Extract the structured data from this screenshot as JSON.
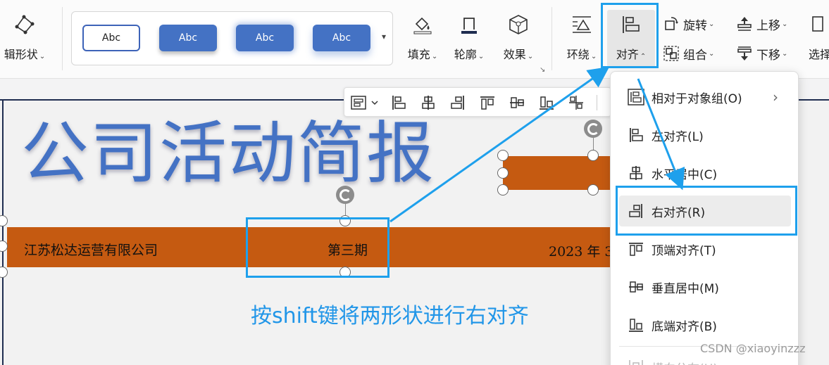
{
  "ribbon": {
    "edit_shape": {
      "label": "辑形状",
      "icon": "edit-points-icon"
    },
    "style_gallery": {
      "samples": [
        "Abc",
        "Abc",
        "Abc",
        "Abc"
      ],
      "more_icon": "gallery-more-icon"
    },
    "fill": {
      "label": "填充",
      "icon": "paint-bucket-icon"
    },
    "outline": {
      "label": "轮廓",
      "icon": "outline-pen-icon"
    },
    "effect": {
      "label": "效果",
      "icon": "effect-cube-icon"
    },
    "wrap": {
      "label": "环绕",
      "icon": "text-wrap-icon"
    },
    "align": {
      "label": "对齐",
      "icon": "align-icon",
      "active": true
    },
    "rotate": {
      "label": "旋转",
      "icon": "rotate-icon"
    },
    "group": {
      "label": "组合",
      "icon": "group-icon"
    },
    "move_up": {
      "label": "上移",
      "icon": "move-up-icon"
    },
    "move_down": {
      "label": "下移",
      "icon": "move-down-icon"
    },
    "select": {
      "label": "选择",
      "icon": "select-icon"
    }
  },
  "slide": {
    "title": "公司活动简报",
    "bar": {
      "company": "江苏松达运营有限公司",
      "issue": "第三期",
      "date": "2023 年 3"
    },
    "caption": "按shift键将两形状进行右对齐"
  },
  "mini_toolbar": {
    "icons": [
      "align-menu-icon",
      "align-left-icon",
      "align-center-h-icon",
      "align-right-icon",
      "align-top-icon",
      "align-middle-v-icon",
      "align-bottom-icon",
      "distribute-icon"
    ]
  },
  "align_menu": {
    "items": [
      {
        "label": "相对于对象组(O)",
        "icon": "relative-group-icon",
        "submenu": true
      },
      {
        "label": "左对齐(L)",
        "icon": "align-left-icon"
      },
      {
        "label": "水平居中(C)",
        "icon": "align-center-h-icon"
      },
      {
        "label": "右对齐(R)",
        "icon": "align-right-icon",
        "highlighted": true
      },
      {
        "label": "顶端对齐(T)",
        "icon": "align-top-icon"
      },
      {
        "label": "垂直居中(M)",
        "icon": "align-middle-v-icon"
      },
      {
        "label": "底端对齐(B)",
        "icon": "align-bottom-icon"
      },
      {
        "label": "横向分布(H)",
        "icon": "distribute-h-icon",
        "disabled": true
      }
    ]
  },
  "watermark": "CSDN @xiaoyinzzz",
  "colors": {
    "accent_blue": "#4472c4",
    "orange": "#c55a11",
    "highlight": "#1ea0ec"
  }
}
